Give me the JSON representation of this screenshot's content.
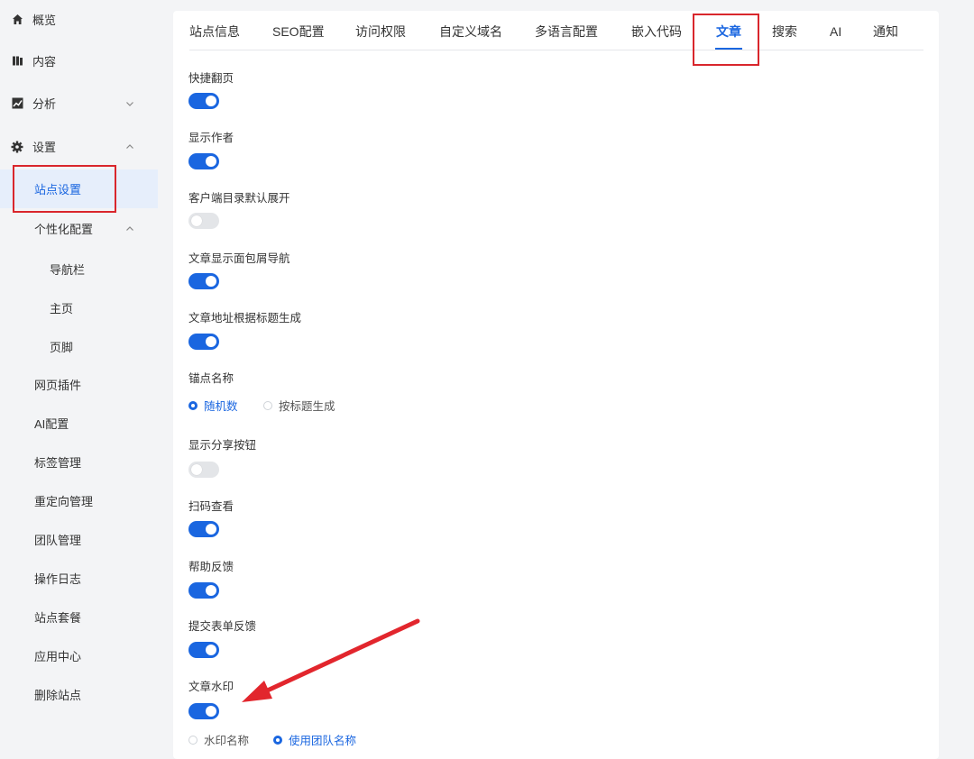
{
  "sidebar": {
    "items": [
      {
        "label": "概览",
        "icon": "home-icon"
      },
      {
        "label": "内容",
        "icon": "content-icon"
      },
      {
        "label": "分析",
        "icon": "chart-icon"
      },
      {
        "label": "设置",
        "icon": "gear-icon"
      },
      {
        "label": "站点设置",
        "active": true
      },
      {
        "label": "个性化配置"
      },
      {
        "label": "导航栏"
      },
      {
        "label": "主页"
      },
      {
        "label": "页脚"
      },
      {
        "label": "网页插件"
      },
      {
        "label": "AI配置"
      },
      {
        "label": "标签管理"
      },
      {
        "label": "重定向管理"
      },
      {
        "label": "团队管理"
      },
      {
        "label": "操作日志"
      },
      {
        "label": "站点套餐"
      },
      {
        "label": "应用中心"
      },
      {
        "label": "删除站点"
      }
    ]
  },
  "tabs": [
    "站点信息",
    "SEO配置",
    "访问权限",
    "自定义域名",
    "多语言配置",
    "嵌入代码",
    "文章",
    "搜索",
    "AI",
    "通知"
  ],
  "active_tab": "文章",
  "settings": {
    "quick_page": {
      "label": "快捷翻页",
      "enabled": true
    },
    "show_author": {
      "label": "显示作者",
      "enabled": true
    },
    "client_toc_expand": {
      "label": "客户端目录默认展开",
      "enabled": false
    },
    "breadcrumb": {
      "label": "文章显示面包屑导航",
      "enabled": true
    },
    "slug_from_title": {
      "label": "文章地址根据标题生成",
      "enabled": true
    },
    "anchor_name": {
      "label": "锚点名称",
      "options": [
        "随机数",
        "按标题生成"
      ],
      "selected": "随机数"
    },
    "share_button": {
      "label": "显示分享按钮",
      "enabled": false
    },
    "scan_qr": {
      "label": "扫码查看",
      "enabled": true
    },
    "help_feedback": {
      "label": "帮助反馈",
      "enabled": true
    },
    "form_feedback": {
      "label": "提交表单反馈",
      "enabled": true
    },
    "watermark": {
      "label": "文章水印",
      "enabled": true,
      "options": [
        "水印名称",
        "使用团队名称"
      ],
      "selected": "使用团队名称"
    }
  },
  "colors": {
    "accent": "#1a66e0",
    "highlight": "#d9262c"
  }
}
